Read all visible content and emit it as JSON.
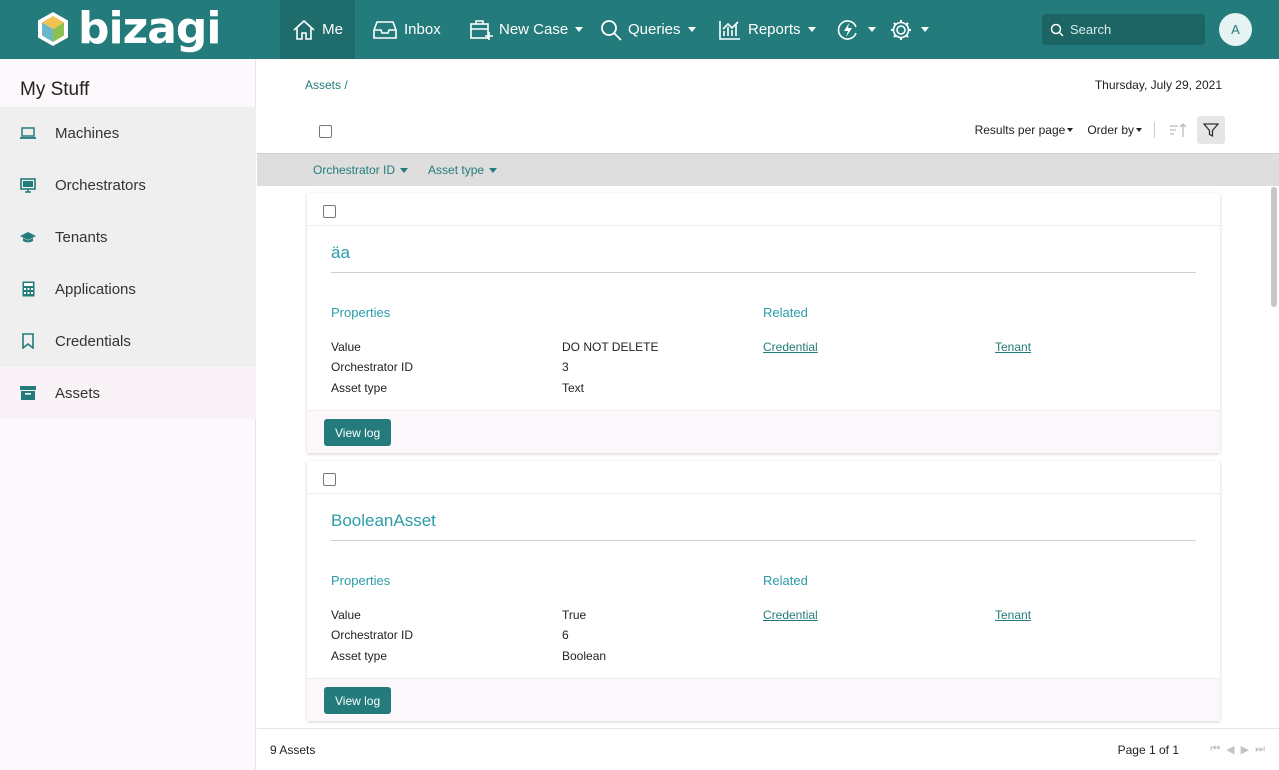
{
  "brand": {
    "name": "bizagi"
  },
  "nav": {
    "me": "Me",
    "inbox": "Inbox",
    "new_case": "New Case",
    "queries": "Queries",
    "reports": "Reports"
  },
  "search": {
    "placeholder": "Search"
  },
  "user": {
    "initial": "A"
  },
  "sidebar": {
    "title": "My Stuff",
    "items": [
      {
        "label": "Machines",
        "icon": "laptop-icon"
      },
      {
        "label": "Orchestrators",
        "icon": "monitor-icon"
      },
      {
        "label": "Tenants",
        "icon": "graduation-cap-icon"
      },
      {
        "label": "Applications",
        "icon": "calculator-icon"
      },
      {
        "label": "Credentials",
        "icon": "bookmark-icon"
      },
      {
        "label": "Assets",
        "icon": "archive-icon"
      }
    ],
    "active": "Assets"
  },
  "main": {
    "breadcrumb": "Assets /",
    "date": "Thursday, July 29, 2021",
    "toolbar": {
      "results_per_page": "Results per page",
      "order_by": "Order by"
    },
    "filters": [
      "Orchestrator ID",
      "Asset type"
    ],
    "cards": [
      {
        "title": "äa",
        "properties_label": "Properties",
        "related_label": "Related",
        "properties": [
          {
            "label": "Value",
            "value": "DO NOT DELETE"
          },
          {
            "label": "Orchestrator ID",
            "value": "3"
          },
          {
            "label": "Asset type",
            "value": "Text"
          }
        ],
        "related": [
          "Credential",
          "Tenant"
        ],
        "button": "View log"
      },
      {
        "title": "BooleanAsset",
        "properties_label": "Properties",
        "related_label": "Related",
        "properties": [
          {
            "label": "Value",
            "value": "True"
          },
          {
            "label": "Orchestrator ID",
            "value": "6"
          },
          {
            "label": "Asset type",
            "value": "Boolean"
          }
        ],
        "related": [
          "Credential",
          "Tenant"
        ],
        "button": "View log"
      }
    ],
    "footer": {
      "count": "9 Assets",
      "page": "Page 1 of 1"
    }
  },
  "colors": {
    "primary": "#247b7b",
    "accent": "#2a9da8"
  }
}
